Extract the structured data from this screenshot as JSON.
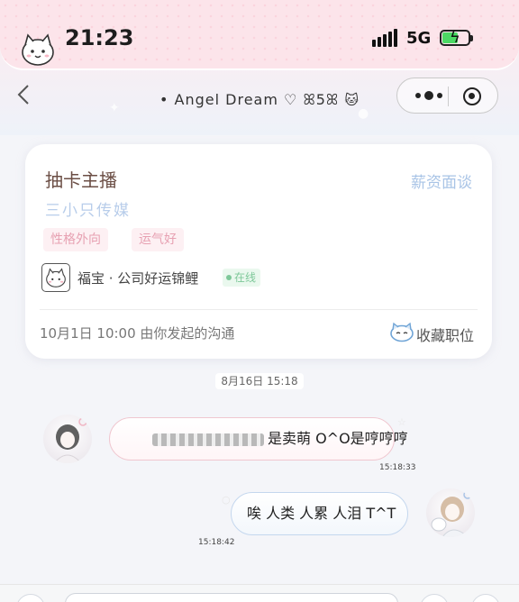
{
  "status_bar": {
    "time": "21:23",
    "network": "5G"
  },
  "nav": {
    "title": "• Angel Dream ♡ ꕤ5ꕤ",
    "title_cat": "🐱"
  },
  "job_card": {
    "title": "抽卡主播",
    "salary": "薪资面谈",
    "company": "三小只传媒",
    "tags": [
      "性格外向",
      "运气好"
    ],
    "recruiter": "福宝 · 公司好运锦鲤",
    "online": "在线",
    "conversation_info": "10月1日 10:00 由你发起的沟通",
    "favorite_label": "收藏职位"
  },
  "chat": {
    "date_separator": "8月16日 15:18",
    "messages": [
      {
        "from": "other",
        "text": "是卖萌 O^O是哼哼哼",
        "timestamp": "15:18:33"
      },
      {
        "from": "me",
        "text": "唉 人类 人累 人泪 T^T",
        "timestamp": "15:18:42"
      }
    ]
  },
  "colors": {
    "status_pink": "#fce4ea",
    "title_brown": "#6b4e45",
    "salary_blue": "#a9c4e6",
    "tag_pink": "#e7a1b2",
    "online_green": "#7ec899"
  },
  "icons": [
    "cat-sticker-icon",
    "signal-icon",
    "battery-charging-icon",
    "back-chevron-icon",
    "more-dots-icon",
    "target-circle-icon",
    "cat-favorite-icon"
  ]
}
